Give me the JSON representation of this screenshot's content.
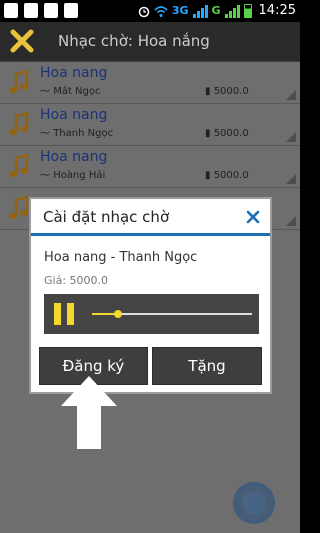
{
  "status_bar": {
    "icons": [
      "facebook-icon",
      "gallery-icon",
      "warning-icon",
      "checkbox-icon"
    ],
    "network_3g": "3G",
    "network_g": "G",
    "time": "14:25"
  },
  "app_bar": {
    "title": "Nhạc chờ: Hoa nắng"
  },
  "list": {
    "rows": [
      {
        "song": "Hoa nang",
        "artist": "Mắt Ngọc",
        "price": "5000.0"
      },
      {
        "song": "Hoa nang",
        "artist": "Thanh Ngọc",
        "price": "5000.0"
      },
      {
        "song": "Hoa nang",
        "artist": "Hoàng Hải",
        "price": "5000.0"
      },
      {
        "song": "",
        "artist": "",
        "price": ""
      }
    ]
  },
  "dialog": {
    "title": "Cài đặt nhạc chờ",
    "track": "Hoa nang - Thanh Ngọc",
    "price": "Giá: 5000.0",
    "progress": 0.16,
    "register_label": "Đăng ký",
    "gift_label": "Tặng"
  },
  "colors": {
    "accent": "#1a6fb7",
    "player_yellow": "#f2d82a",
    "song_title": "#2b4fb3"
  }
}
